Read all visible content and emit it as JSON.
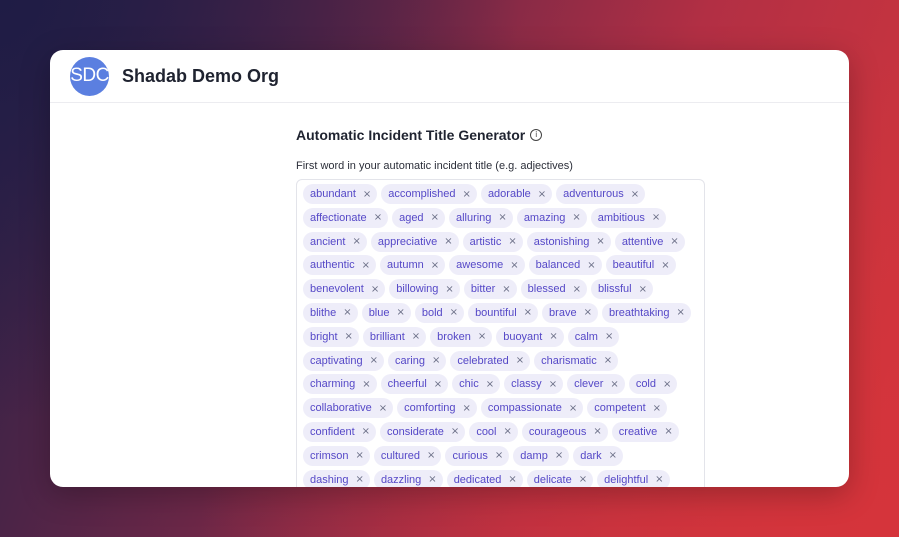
{
  "org": {
    "initials": "SDC",
    "name": "Shadab Demo Org"
  },
  "page": {
    "title": "Automatic Incident Title Generator",
    "info_icon": "i",
    "field_label": "First word in your automatic incident title (e.g. adjectives)"
  },
  "remove_glyph": "×",
  "tag_rows": [
    [
      "abundant",
      "accomplished",
      "adorable",
      "adventurous"
    ],
    [
      "affectionate",
      "aged",
      "alluring",
      "amazing",
      "ambitious"
    ],
    [
      "ancient",
      "appreciative",
      "artistic",
      "astonishing",
      "attentive"
    ],
    [
      "authentic",
      "autumn",
      "awesome",
      "balanced",
      "beautiful"
    ],
    [
      "benevolent",
      "billowing",
      "bitter",
      "blessed",
      "blissful"
    ],
    [
      "blithe",
      "blue",
      "bold",
      "bountiful",
      "brave",
      "breathtaking"
    ],
    [
      "bright",
      "brilliant",
      "broken",
      "buoyant",
      "calm"
    ],
    [
      "captivating",
      "caring",
      "celebrated",
      "charismatic"
    ],
    [
      "charming",
      "cheerful",
      "chic",
      "classy",
      "clever",
      "cold"
    ],
    [
      "collaborative",
      "comforting",
      "compassionate",
      "competent"
    ],
    [
      "confident",
      "considerate",
      "cool",
      "courageous",
      "creative"
    ],
    [
      "crimson",
      "cultured",
      "curious",
      "damp",
      "dark"
    ],
    [
      "dashing",
      "dazzling",
      "dedicated",
      "delicate",
      "delightful"
    ]
  ]
}
